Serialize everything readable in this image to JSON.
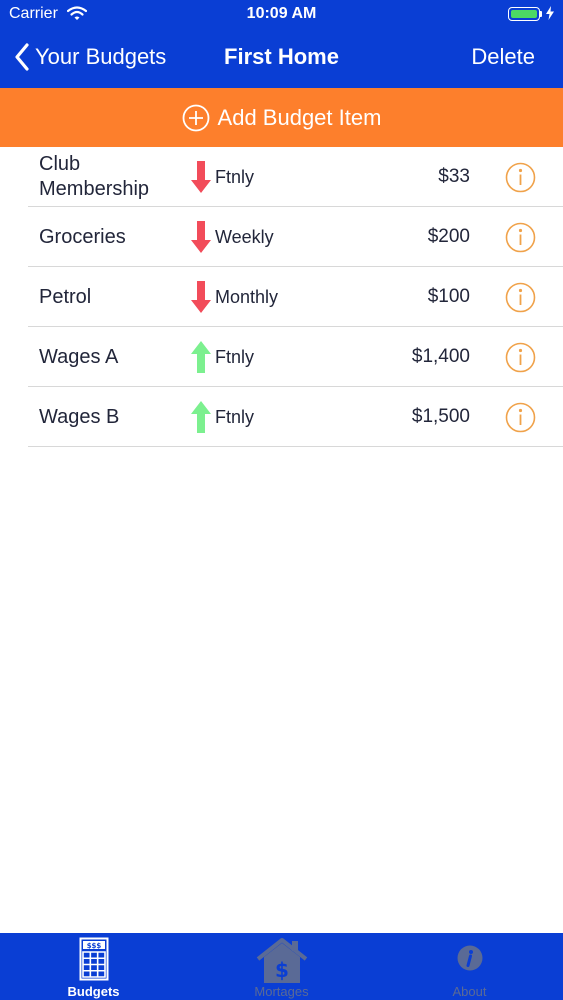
{
  "status_bar": {
    "carrier": "Carrier",
    "time": "10:09 AM"
  },
  "nav": {
    "back_label": "Your Budgets",
    "title": "First Home",
    "delete_label": "Delete"
  },
  "add_button": {
    "label": "Add Budget Item"
  },
  "items": [
    {
      "name": "Club Membership",
      "direction": "down",
      "frequency": "Ftnly",
      "amount": "$33"
    },
    {
      "name": "Groceries",
      "direction": "down",
      "frequency": "Weekly",
      "amount": "$200"
    },
    {
      "name": "Petrol",
      "direction": "down",
      "frequency": "Monthly",
      "amount": "$100"
    },
    {
      "name": "Wages A",
      "direction": "up",
      "frequency": "Ftnly",
      "amount": "$1,400"
    },
    {
      "name": "Wages B",
      "direction": "up",
      "frequency": "Ftnly",
      "amount": "$1,500"
    }
  ],
  "tabs": [
    {
      "label": "Budgets",
      "icon": "calculator-icon",
      "active": true
    },
    {
      "label": "Mortages",
      "icon": "house-dollar-icon",
      "active": false
    },
    {
      "label": "About",
      "icon": "info-icon",
      "active": false
    }
  ],
  "colors": {
    "header": "#0a3ed4",
    "add_bar": "#fd7f2c",
    "expense_arrow": "#f24c5a",
    "income_arrow": "#7cf08f",
    "info_icon": "#f0a24a",
    "battery": "#4cd964"
  }
}
